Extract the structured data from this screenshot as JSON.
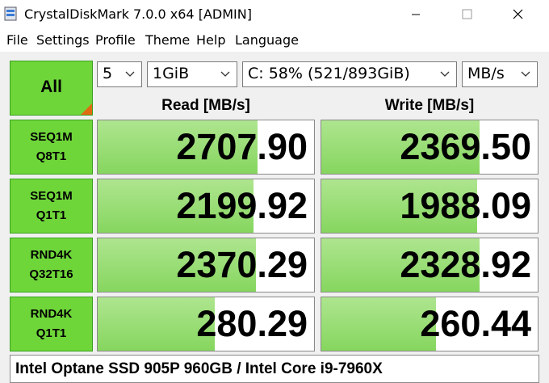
{
  "window": {
    "title": "CrystalDiskMark 7.0.0 x64 [ADMIN]",
    "controls": [
      "minimize",
      "maximize",
      "close"
    ]
  },
  "menu": [
    {
      "label": "File"
    },
    {
      "label": "Settings"
    },
    {
      "label": "Profile"
    },
    {
      "label": "Theme"
    },
    {
      "label": "Help"
    },
    {
      "label": "Language"
    }
  ],
  "controls": {
    "all_label": "All",
    "count": "5",
    "size": "1GiB",
    "drive": "C: 58% (521/893GiB)",
    "unit": "MB/s"
  },
  "headers": {
    "read": "Read [MB/s]",
    "write": "Write [MB/s]"
  },
  "tests": [
    {
      "line1": "SEQ1M",
      "line2": "Q8T1",
      "read": "2707.90",
      "write": "2369.50",
      "read_fill": 0.74,
      "write_fill": 0.73
    },
    {
      "line1": "SEQ1M",
      "line2": "Q1T1",
      "read": "2199.92",
      "write": "1988.09",
      "read_fill": 0.72,
      "write_fill": 0.72
    },
    {
      "line1": "RND4K",
      "line2": "Q32T16",
      "read": "2370.29",
      "write": "2328.92",
      "read_fill": 0.73,
      "write_fill": 0.73
    },
    {
      "line1": "RND4K",
      "line2": "Q1T1",
      "read": "280.29",
      "write": "260.44",
      "read_fill": 0.54,
      "write_fill": 0.53
    }
  ],
  "comment": "Intel Optane SSD 905P 960GB / Intel Core i9-7960X",
  "colors": {
    "button_green": "#6fd63a",
    "bar_green": "#86d65f",
    "corner_orange": "#e06b10"
  }
}
